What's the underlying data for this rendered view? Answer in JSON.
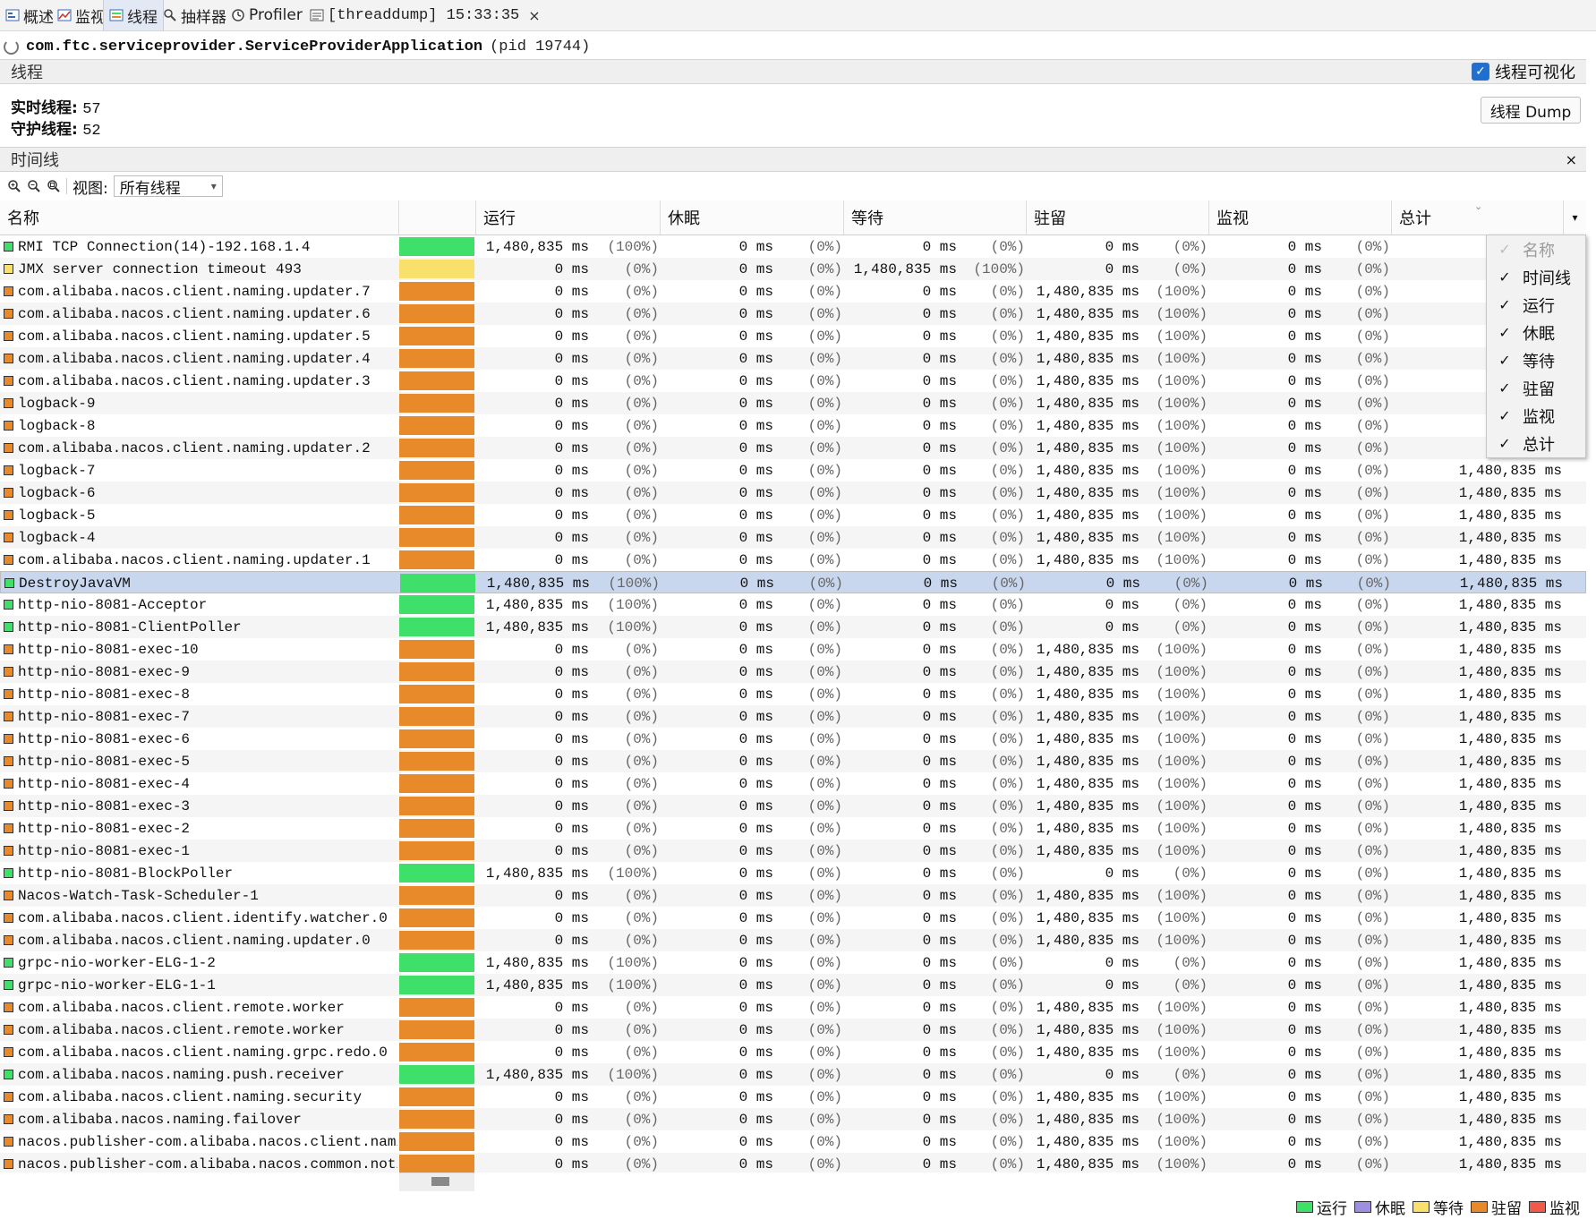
{
  "tabs": [
    {
      "label": "概述",
      "icon": "overview-icon"
    },
    {
      "label": "监视",
      "icon": "monitor-icon"
    },
    {
      "label": "线程",
      "icon": "threads-icon"
    },
    {
      "label": "抽样器",
      "icon": "sampler-icon"
    },
    {
      "label": "Profiler",
      "icon": "profiler-icon"
    },
    {
      "label": "[threaddump] 15:33:35",
      "icon": "threaddump-icon"
    }
  ],
  "process": {
    "app": "com.ftc.serviceprovider.ServiceProviderApplication",
    "pid": "(pid 19744)"
  },
  "threads_section": {
    "title": "线程",
    "visualize_label": "线程可视化",
    "live_label": "实时线程:",
    "live_value": "57",
    "daemon_label": "守护线程:",
    "daemon_value": "52",
    "dump_button": "线程 Dump"
  },
  "timeline_section": {
    "title": "时间线",
    "close": "×"
  },
  "toolbar": {
    "view_label": "视图:",
    "view_value": "所有线程"
  },
  "columns": [
    "名称",
    "",
    "运行",
    "休眠",
    "等待",
    "驻留",
    "监视",
    "总计"
  ],
  "colors": {
    "run": "#3ee06a",
    "sleep": "#9e8fe0",
    "wait": "#f8e06a",
    "park": "#e88a2a",
    "monitor": "#ef5a4a"
  },
  "threads": [
    {
      "name": "RMI TCP Connection(14)-192.168.1.4",
      "state": "run",
      "run": "1,480,835",
      "run_p": "(100%)",
      "sleep": "0",
      "sleep_p": "(0%)",
      "wait": "0",
      "wait_p": "(0%)",
      "park": "0",
      "park_p": "(0%)",
      "mon": "0",
      "mon_p": "(0%)",
      "total": "1,4"
    },
    {
      "name": "JMX server connection timeout 493",
      "state": "wait",
      "run": "0",
      "run_p": "(0%)",
      "sleep": "0",
      "sleep_p": "(0%)",
      "wait": "1,480,835",
      "wait_p": "(100%)",
      "park": "0",
      "park_p": "(0%)",
      "mon": "0",
      "mon_p": "(0%)",
      "total": "1,4"
    },
    {
      "name": "com.alibaba.nacos.client.naming.updater.7",
      "state": "park",
      "run": "0",
      "run_p": "(0%)",
      "sleep": "0",
      "sleep_p": "(0%)",
      "wait": "0",
      "wait_p": "(0%)",
      "park": "1,480,835",
      "park_p": "(100%)",
      "mon": "0",
      "mon_p": "(0%)",
      "total": "1,4"
    },
    {
      "name": "com.alibaba.nacos.client.naming.updater.6",
      "state": "park",
      "run": "0",
      "run_p": "(0%)",
      "sleep": "0",
      "sleep_p": "(0%)",
      "wait": "0",
      "wait_p": "(0%)",
      "park": "1,480,835",
      "park_p": "(100%)",
      "mon": "0",
      "mon_p": "(0%)",
      "total": "1,4"
    },
    {
      "name": "com.alibaba.nacos.client.naming.updater.5",
      "state": "park",
      "run": "0",
      "run_p": "(0%)",
      "sleep": "0",
      "sleep_p": "(0%)",
      "wait": "0",
      "wait_p": "(0%)",
      "park": "1,480,835",
      "park_p": "(100%)",
      "mon": "0",
      "mon_p": "(0%)",
      "total": "1,4"
    },
    {
      "name": "com.alibaba.nacos.client.naming.updater.4",
      "state": "park",
      "run": "0",
      "run_p": "(0%)",
      "sleep": "0",
      "sleep_p": "(0%)",
      "wait": "0",
      "wait_p": "(0%)",
      "park": "1,480,835",
      "park_p": "(100%)",
      "mon": "0",
      "mon_p": "(0%)",
      "total": "1,4"
    },
    {
      "name": "com.alibaba.nacos.client.naming.updater.3",
      "state": "park",
      "run": "0",
      "run_p": "(0%)",
      "sleep": "0",
      "sleep_p": "(0%)",
      "wait": "0",
      "wait_p": "(0%)",
      "park": "1,480,835",
      "park_p": "(100%)",
      "mon": "0",
      "mon_p": "(0%)",
      "total": "1,4"
    },
    {
      "name": "logback-9",
      "state": "park",
      "run": "0",
      "run_p": "(0%)",
      "sleep": "0",
      "sleep_p": "(0%)",
      "wait": "0",
      "wait_p": "(0%)",
      "park": "1,480,835",
      "park_p": "(100%)",
      "mon": "0",
      "mon_p": "(0%)",
      "total": "1,4"
    },
    {
      "name": "logback-8",
      "state": "park",
      "run": "0",
      "run_p": "(0%)",
      "sleep": "0",
      "sleep_p": "(0%)",
      "wait": "0",
      "wait_p": "(0%)",
      "park": "1,480,835",
      "park_p": "(100%)",
      "mon": "0",
      "mon_p": "(0%)",
      "total": "1,4"
    },
    {
      "name": "com.alibaba.nacos.client.naming.updater.2",
      "state": "park",
      "run": "0",
      "run_p": "(0%)",
      "sleep": "0",
      "sleep_p": "(0%)",
      "wait": "0",
      "wait_p": "(0%)",
      "park": "1,480,835",
      "park_p": "(100%)",
      "mon": "0",
      "mon_p": "(0%)",
      "total": "1,4"
    },
    {
      "name": "logback-7",
      "state": "park",
      "run": "0",
      "run_p": "(0%)",
      "sleep": "0",
      "sleep_p": "(0%)",
      "wait": "0",
      "wait_p": "(0%)",
      "park": "1,480,835",
      "park_p": "(100%)",
      "mon": "0",
      "mon_p": "(0%)",
      "total": "1,480,835"
    },
    {
      "name": "logback-6",
      "state": "park",
      "run": "0",
      "run_p": "(0%)",
      "sleep": "0",
      "sleep_p": "(0%)",
      "wait": "0",
      "wait_p": "(0%)",
      "park": "1,480,835",
      "park_p": "(100%)",
      "mon": "0",
      "mon_p": "(0%)",
      "total": "1,480,835"
    },
    {
      "name": "logback-5",
      "state": "park",
      "run": "0",
      "run_p": "(0%)",
      "sleep": "0",
      "sleep_p": "(0%)",
      "wait": "0",
      "wait_p": "(0%)",
      "park": "1,480,835",
      "park_p": "(100%)",
      "mon": "0",
      "mon_p": "(0%)",
      "total": "1,480,835"
    },
    {
      "name": "logback-4",
      "state": "park",
      "run": "0",
      "run_p": "(0%)",
      "sleep": "0",
      "sleep_p": "(0%)",
      "wait": "0",
      "wait_p": "(0%)",
      "park": "1,480,835",
      "park_p": "(100%)",
      "mon": "0",
      "mon_p": "(0%)",
      "total": "1,480,835"
    },
    {
      "name": "com.alibaba.nacos.client.naming.updater.1",
      "state": "park",
      "run": "0",
      "run_p": "(0%)",
      "sleep": "0",
      "sleep_p": "(0%)",
      "wait": "0",
      "wait_p": "(0%)",
      "park": "1,480,835",
      "park_p": "(100%)",
      "mon": "0",
      "mon_p": "(0%)",
      "total": "1,480,835"
    },
    {
      "name": "DestroyJavaVM",
      "state": "run",
      "selected": true,
      "run": "1,480,835",
      "run_p": "(100%)",
      "sleep": "0",
      "sleep_p": "(0%)",
      "wait": "0",
      "wait_p": "(0%)",
      "park": "0",
      "park_p": "(0%)",
      "mon": "0",
      "mon_p": "(0%)",
      "total": "1,480,835"
    },
    {
      "name": "http-nio-8081-Acceptor",
      "state": "run",
      "run": "1,480,835",
      "run_p": "(100%)",
      "sleep": "0",
      "sleep_p": "(0%)",
      "wait": "0",
      "wait_p": "(0%)",
      "park": "0",
      "park_p": "(0%)",
      "mon": "0",
      "mon_p": "(0%)",
      "total": "1,480,835"
    },
    {
      "name": "http-nio-8081-ClientPoller",
      "state": "run",
      "run": "1,480,835",
      "run_p": "(100%)",
      "sleep": "0",
      "sleep_p": "(0%)",
      "wait": "0",
      "wait_p": "(0%)",
      "park": "0",
      "park_p": "(0%)",
      "mon": "0",
      "mon_p": "(0%)",
      "total": "1,480,835"
    },
    {
      "name": "http-nio-8081-exec-10",
      "state": "park",
      "run": "0",
      "run_p": "(0%)",
      "sleep": "0",
      "sleep_p": "(0%)",
      "wait": "0",
      "wait_p": "(0%)",
      "park": "1,480,835",
      "park_p": "(100%)",
      "mon": "0",
      "mon_p": "(0%)",
      "total": "1,480,835"
    },
    {
      "name": "http-nio-8081-exec-9",
      "state": "park",
      "run": "0",
      "run_p": "(0%)",
      "sleep": "0",
      "sleep_p": "(0%)",
      "wait": "0",
      "wait_p": "(0%)",
      "park": "1,480,835",
      "park_p": "(100%)",
      "mon": "0",
      "mon_p": "(0%)",
      "total": "1,480,835"
    },
    {
      "name": "http-nio-8081-exec-8",
      "state": "park",
      "run": "0",
      "run_p": "(0%)",
      "sleep": "0",
      "sleep_p": "(0%)",
      "wait": "0",
      "wait_p": "(0%)",
      "park": "1,480,835",
      "park_p": "(100%)",
      "mon": "0",
      "mon_p": "(0%)",
      "total": "1,480,835"
    },
    {
      "name": "http-nio-8081-exec-7",
      "state": "park",
      "run": "0",
      "run_p": "(0%)",
      "sleep": "0",
      "sleep_p": "(0%)",
      "wait": "0",
      "wait_p": "(0%)",
      "park": "1,480,835",
      "park_p": "(100%)",
      "mon": "0",
      "mon_p": "(0%)",
      "total": "1,480,835"
    },
    {
      "name": "http-nio-8081-exec-6",
      "state": "park",
      "run": "0",
      "run_p": "(0%)",
      "sleep": "0",
      "sleep_p": "(0%)",
      "wait": "0",
      "wait_p": "(0%)",
      "park": "1,480,835",
      "park_p": "(100%)",
      "mon": "0",
      "mon_p": "(0%)",
      "total": "1,480,835"
    },
    {
      "name": "http-nio-8081-exec-5",
      "state": "park",
      "run": "0",
      "run_p": "(0%)",
      "sleep": "0",
      "sleep_p": "(0%)",
      "wait": "0",
      "wait_p": "(0%)",
      "park": "1,480,835",
      "park_p": "(100%)",
      "mon": "0",
      "mon_p": "(0%)",
      "total": "1,480,835"
    },
    {
      "name": "http-nio-8081-exec-4",
      "state": "park",
      "run": "0",
      "run_p": "(0%)",
      "sleep": "0",
      "sleep_p": "(0%)",
      "wait": "0",
      "wait_p": "(0%)",
      "park": "1,480,835",
      "park_p": "(100%)",
      "mon": "0",
      "mon_p": "(0%)",
      "total": "1,480,835"
    },
    {
      "name": "http-nio-8081-exec-3",
      "state": "park",
      "run": "0",
      "run_p": "(0%)",
      "sleep": "0",
      "sleep_p": "(0%)",
      "wait": "0",
      "wait_p": "(0%)",
      "park": "1,480,835",
      "park_p": "(100%)",
      "mon": "0",
      "mon_p": "(0%)",
      "total": "1,480,835"
    },
    {
      "name": "http-nio-8081-exec-2",
      "state": "park",
      "run": "0",
      "run_p": "(0%)",
      "sleep": "0",
      "sleep_p": "(0%)",
      "wait": "0",
      "wait_p": "(0%)",
      "park": "1,480,835",
      "park_p": "(100%)",
      "mon": "0",
      "mon_p": "(0%)",
      "total": "1,480,835"
    },
    {
      "name": "http-nio-8081-exec-1",
      "state": "park",
      "run": "0",
      "run_p": "(0%)",
      "sleep": "0",
      "sleep_p": "(0%)",
      "wait": "0",
      "wait_p": "(0%)",
      "park": "1,480,835",
      "park_p": "(100%)",
      "mon": "0",
      "mon_p": "(0%)",
      "total": "1,480,835"
    },
    {
      "name": "http-nio-8081-BlockPoller",
      "state": "run",
      "run": "1,480,835",
      "run_p": "(100%)",
      "sleep": "0",
      "sleep_p": "(0%)",
      "wait": "0",
      "wait_p": "(0%)",
      "park": "0",
      "park_p": "(0%)",
      "mon": "0",
      "mon_p": "(0%)",
      "total": "1,480,835"
    },
    {
      "name": "Nacos-Watch-Task-Scheduler-1",
      "state": "park",
      "run": "0",
      "run_p": "(0%)",
      "sleep": "0",
      "sleep_p": "(0%)",
      "wait": "0",
      "wait_p": "(0%)",
      "park": "1,480,835",
      "park_p": "(100%)",
      "mon": "0",
      "mon_p": "(0%)",
      "total": "1,480,835"
    },
    {
      "name": "com.alibaba.nacos.client.identify.watcher.0",
      "state": "park",
      "run": "0",
      "run_p": "(0%)",
      "sleep": "0",
      "sleep_p": "(0%)",
      "wait": "0",
      "wait_p": "(0%)",
      "park": "1,480,835",
      "park_p": "(100%)",
      "mon": "0",
      "mon_p": "(0%)",
      "total": "1,480,835"
    },
    {
      "name": "com.alibaba.nacos.client.naming.updater.0",
      "state": "park",
      "run": "0",
      "run_p": "(0%)",
      "sleep": "0",
      "sleep_p": "(0%)",
      "wait": "0",
      "wait_p": "(0%)",
      "park": "1,480,835",
      "park_p": "(100%)",
      "mon": "0",
      "mon_p": "(0%)",
      "total": "1,480,835"
    },
    {
      "name": "grpc-nio-worker-ELG-1-2",
      "state": "run",
      "run": "1,480,835",
      "run_p": "(100%)",
      "sleep": "0",
      "sleep_p": "(0%)",
      "wait": "0",
      "wait_p": "(0%)",
      "park": "0",
      "park_p": "(0%)",
      "mon": "0",
      "mon_p": "(0%)",
      "total": "1,480,835"
    },
    {
      "name": "grpc-nio-worker-ELG-1-1",
      "state": "run",
      "run": "1,480,835",
      "run_p": "(100%)",
      "sleep": "0",
      "sleep_p": "(0%)",
      "wait": "0",
      "wait_p": "(0%)",
      "park": "0",
      "park_p": "(0%)",
      "mon": "0",
      "mon_p": "(0%)",
      "total": "1,480,835"
    },
    {
      "name": "com.alibaba.nacos.client.remote.worker",
      "state": "park",
      "run": "0",
      "run_p": "(0%)",
      "sleep": "0",
      "sleep_p": "(0%)",
      "wait": "0",
      "wait_p": "(0%)",
      "park": "1,480,835",
      "park_p": "(100%)",
      "mon": "0",
      "mon_p": "(0%)",
      "total": "1,480,835"
    },
    {
      "name": "com.alibaba.nacos.client.remote.worker",
      "state": "park",
      "run": "0",
      "run_p": "(0%)",
      "sleep": "0",
      "sleep_p": "(0%)",
      "wait": "0",
      "wait_p": "(0%)",
      "park": "1,480,835",
      "park_p": "(100%)",
      "mon": "0",
      "mon_p": "(0%)",
      "total": "1,480,835"
    },
    {
      "name": "com.alibaba.nacos.client.naming.grpc.redo.0",
      "state": "park",
      "run": "0",
      "run_p": "(0%)",
      "sleep": "0",
      "sleep_p": "(0%)",
      "wait": "0",
      "wait_p": "(0%)",
      "park": "1,480,835",
      "park_p": "(100%)",
      "mon": "0",
      "mon_p": "(0%)",
      "total": "1,480,835"
    },
    {
      "name": "com.alibaba.nacos.naming.push.receiver",
      "state": "run",
      "run": "1,480,835",
      "run_p": "(100%)",
      "sleep": "0",
      "sleep_p": "(0%)",
      "wait": "0",
      "wait_p": "(0%)",
      "park": "0",
      "park_p": "(0%)",
      "mon": "0",
      "mon_p": "(0%)",
      "total": "1,480,835"
    },
    {
      "name": "com.alibaba.nacos.client.naming.security",
      "state": "park",
      "run": "0",
      "run_p": "(0%)",
      "sleep": "0",
      "sleep_p": "(0%)",
      "wait": "0",
      "wait_p": "(0%)",
      "park": "1,480,835",
      "park_p": "(100%)",
      "mon": "0",
      "mon_p": "(0%)",
      "total": "1,480,835"
    },
    {
      "name": "com.alibaba.nacos.naming.failover",
      "state": "park",
      "run": "0",
      "run_p": "(0%)",
      "sleep": "0",
      "sleep_p": "(0%)",
      "wait": "0",
      "wait_p": "(0%)",
      "park": "1,480,835",
      "park_p": "(100%)",
      "mon": "0",
      "mon_p": "(0%)",
      "total": "1,480,835"
    },
    {
      "name": "nacos.publisher-com.alibaba.nacos.client.naming.",
      "state": "park",
      "run": "0",
      "run_p": "(0%)",
      "sleep": "0",
      "sleep_p": "(0%)",
      "wait": "0",
      "wait_p": "(0%)",
      "park": "1,480,835",
      "park_p": "(100%)",
      "mon": "0",
      "mon_p": "(0%)",
      "total": "1,480,835"
    },
    {
      "name": "nacos.publisher-com.alibaba.nacos.common.notify.",
      "state": "park",
      "run": "0",
      "run_p": "(0%)",
      "sleep": "0",
      "sleep_p": "(0%)",
      "wait": "0",
      "wait_p": "(0%)",
      "park": "1,480,835",
      "park_p": "(100%)",
      "mon": "0",
      "mon_p": "(0%)",
      "total": "1,480,835"
    }
  ],
  "unit": "ms",
  "column_menu": [
    {
      "label": "名称",
      "checked": true,
      "disabled": true
    },
    {
      "label": "时间线",
      "checked": true
    },
    {
      "label": "运行",
      "checked": true
    },
    {
      "label": "休眠",
      "checked": true
    },
    {
      "label": "等待",
      "checked": true
    },
    {
      "label": "驻留",
      "checked": true
    },
    {
      "label": "监视",
      "checked": true
    },
    {
      "label": "总计",
      "checked": true
    }
  ],
  "legend": [
    {
      "label": "运行",
      "color": "#3ee06a"
    },
    {
      "label": "休眠",
      "color": "#9e8fe0"
    },
    {
      "label": "等待",
      "color": "#f8e06a"
    },
    {
      "label": "驻留",
      "color": "#e88a2a"
    },
    {
      "label": "监视",
      "color": "#ef5a4a"
    }
  ]
}
